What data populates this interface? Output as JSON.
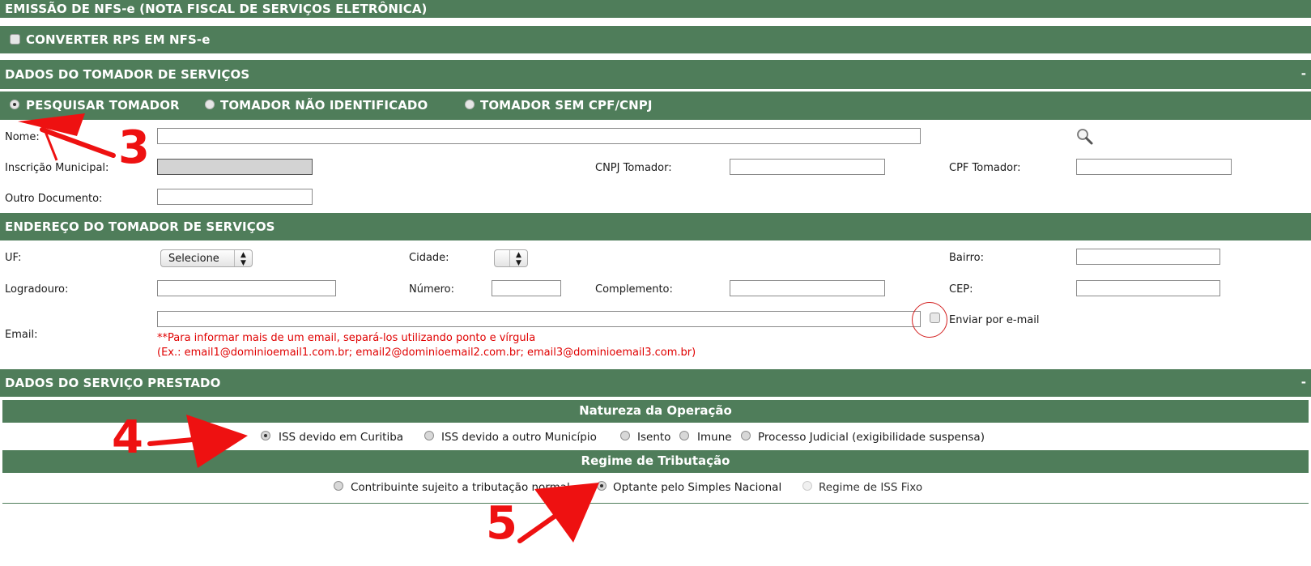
{
  "page_title": "EMISSÃO DE NFS-e (NOTA FISCAL DE SERVIÇOS ELETRÔNICA)",
  "convert_bar": {
    "label": "CONVERTER RPS EM NFS-e",
    "checked": false
  },
  "tomador_section": {
    "title": "DADOS DO TOMADOR DE SERVIÇOS",
    "collapse": "-",
    "options": [
      {
        "label": "PESQUISAR TOMADOR",
        "checked": true
      },
      {
        "label": "TOMADOR NÃO IDENTIFICADO",
        "checked": false
      },
      {
        "label": "TOMADOR SEM CPF/CNPJ",
        "checked": false
      }
    ],
    "fields": {
      "nome": {
        "label": "Nome:",
        "value": ""
      },
      "inscricao": {
        "label": "Inscrição Municipal:",
        "value": ""
      },
      "cnpj": {
        "label": "CNPJ Tomador:",
        "value": ""
      },
      "cpf": {
        "label": "CPF Tomador:",
        "value": ""
      },
      "outro": {
        "label": "Outro Documento:",
        "value": ""
      }
    }
  },
  "endereco_section": {
    "title": "ENDEREÇO DO TOMADOR DE SERVIÇOS",
    "fields": {
      "uf": {
        "label": "UF:",
        "selected": "Selecione"
      },
      "cidade": {
        "label": "Cidade:",
        "selected": ""
      },
      "bairro": {
        "label": "Bairro:",
        "value": ""
      },
      "logradouro": {
        "label": "Logradouro:",
        "value": ""
      },
      "numero": {
        "label": "Número:",
        "value": ""
      },
      "complemento": {
        "label": "Complemento:",
        "value": ""
      },
      "cep": {
        "label": "CEP:",
        "value": ""
      },
      "email": {
        "label": "Email:",
        "value": ""
      }
    },
    "send_email": {
      "label": "Enviar por e-mail",
      "checked": false
    },
    "email_note_1": "**Para informar mais de um email, separá-los utilizando ponto e vírgula",
    "email_note_2": "(Ex.: email1@dominioemail1.com.br; email2@dominioemail2.com.br; email3@dominioemail3.com.br)"
  },
  "servico_section": {
    "title": "DADOS DO SERVIÇO PRESTADO",
    "collapse": "-",
    "natureza": {
      "title": "Natureza da Operação",
      "options": [
        {
          "label": "ISS devido em Curitiba",
          "checked": true
        },
        {
          "label": "ISS devido a outro Município",
          "checked": false
        },
        {
          "label": "Isento",
          "checked": false
        },
        {
          "label": "Imune",
          "checked": false
        },
        {
          "label": "Processo Judicial (exigibilidade suspensa)",
          "checked": false
        }
      ]
    },
    "regime": {
      "title": "Regime de Tributação",
      "options": [
        {
          "label": "Contribuinte sujeito a tributação normal",
          "checked": false
        },
        {
          "label": "Optante pelo Simples Nacional",
          "checked": true
        },
        {
          "label": "Regime de ISS Fixo",
          "checked": false
        }
      ]
    }
  },
  "annotations": {
    "step3": "3",
    "step4": "4",
    "step5": "5"
  },
  "colors": {
    "bar": "#4f7d5a",
    "annotation": "#ee1111"
  }
}
